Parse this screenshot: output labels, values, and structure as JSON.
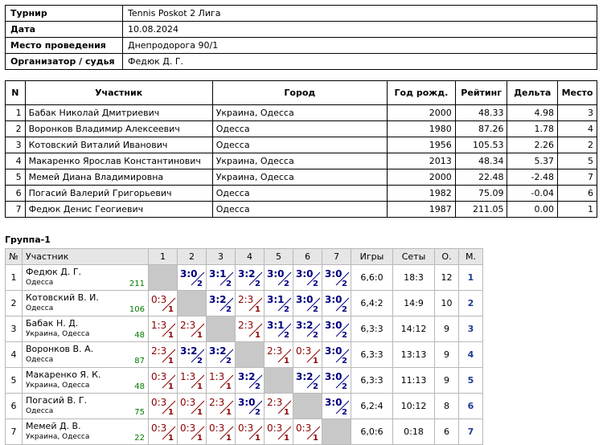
{
  "info": [
    {
      "label": "Турнир",
      "value": "Tennis Poskot   2 Лига"
    },
    {
      "label": "Дата",
      "value": "10.08.2024"
    },
    {
      "label": "Место проведения",
      "value": "Днепродорога 90/1"
    },
    {
      "label": "Организатор / судья",
      "value": "Федюк Д. Г."
    }
  ],
  "participants": {
    "headers": [
      "N",
      "Участник",
      "Город",
      "Год рожд.",
      "Рейтинг",
      "Дельта",
      "Место"
    ],
    "rows": [
      [
        "1",
        "Бабак Николай Дмитриевич",
        "Украина, Одесса",
        "2000",
        "48.33",
        "4.98",
        "3"
      ],
      [
        "2",
        "Воронков Владимир Алексеевич",
        "Одесса",
        "1980",
        "87.26",
        "1.78",
        "4"
      ],
      [
        "3",
        "Котовский Виталий Иванович",
        "Одесса",
        "1956",
        "105.53",
        "2.26",
        "2"
      ],
      [
        "4",
        "Макаренко Ярослав Константинович",
        "Украина, Одесса",
        "2013",
        "48.34",
        "5.37",
        "5"
      ],
      [
        "5",
        "Мемей Диана Владимировна",
        "Украина, Одесса",
        "2000",
        "22.48",
        "-2.48",
        "7"
      ],
      [
        "6",
        "Погасий Валерий Григорьевич",
        "Одесса",
        "1982",
        "75.09",
        "-0.04",
        "6"
      ],
      [
        "7",
        "Федюк Денис Геогиевич",
        "Одесса",
        "1987",
        "211.05",
        "0.00",
        "1"
      ]
    ]
  },
  "group": {
    "title": "Группа-1",
    "headers": [
      "№",
      "Участник",
      "1",
      "2",
      "3",
      "4",
      "5",
      "6",
      "7",
      "Игры",
      "Сеты",
      "О.",
      "М."
    ],
    "rows": [
      {
        "n": "1",
        "name": "Федюк Д. Г.",
        "city": "Одесса",
        "rating": "211",
        "results": [
          null,
          [
            "3:0",
            "2"
          ],
          [
            "3:1",
            "2"
          ],
          [
            "3:2",
            "2"
          ],
          [
            "3:0",
            "2"
          ],
          [
            "3:0",
            "2"
          ],
          [
            "3:0",
            "2"
          ]
        ],
        "games": "6,6:0",
        "sets": "18:3",
        "points": "12",
        "place": "1"
      },
      {
        "n": "2",
        "name": "Котовский В. И.",
        "city": "Одесса",
        "rating": "106",
        "results": [
          [
            "0:3",
            "1"
          ],
          null,
          [
            "3:2",
            "2"
          ],
          [
            "2:3",
            "1"
          ],
          [
            "3:1",
            "2"
          ],
          [
            "3:0",
            "2"
          ],
          [
            "3:0",
            "2"
          ]
        ],
        "games": "6,4:2",
        "sets": "14:9",
        "points": "10",
        "place": "2"
      },
      {
        "n": "3",
        "name": "Бабак Н. Д.",
        "city": "Украина, Одесса",
        "rating": "48",
        "results": [
          [
            "1:3",
            "1"
          ],
          [
            "2:3",
            "1"
          ],
          null,
          [
            "2:3",
            "1"
          ],
          [
            "3:1",
            "2"
          ],
          [
            "3:2",
            "2"
          ],
          [
            "3:0",
            "2"
          ]
        ],
        "games": "6,3:3",
        "sets": "14:12",
        "points": "9",
        "place": "3"
      },
      {
        "n": "4",
        "name": "Воронков В. А.",
        "city": "Одесса",
        "rating": "87",
        "results": [
          [
            "2:3",
            "1"
          ],
          [
            "3:2",
            "2"
          ],
          [
            "3:2",
            "2"
          ],
          null,
          [
            "2:3",
            "1"
          ],
          [
            "0:3",
            "1"
          ],
          [
            "3:0",
            "2"
          ]
        ],
        "games": "6,3:3",
        "sets": "13:13",
        "points": "9",
        "place": "4"
      },
      {
        "n": "5",
        "name": "Макаренко Я. К.",
        "city": "Украина, Одесса",
        "rating": "48",
        "results": [
          [
            "0:3",
            "1"
          ],
          [
            "1:3",
            "1"
          ],
          [
            "1:3",
            "1"
          ],
          [
            "3:2",
            "2"
          ],
          null,
          [
            "3:2",
            "2"
          ],
          [
            "3:0",
            "2"
          ]
        ],
        "games": "6,3:3",
        "sets": "11:13",
        "points": "9",
        "place": "5"
      },
      {
        "n": "6",
        "name": "Погасий В. Г.",
        "city": "Одесса",
        "rating": "75",
        "results": [
          [
            "0:3",
            "1"
          ],
          [
            "0:3",
            "1"
          ],
          [
            "2:3",
            "1"
          ],
          [
            "3:0",
            "2"
          ],
          [
            "2:3",
            "1"
          ],
          null,
          [
            "3:0",
            "2"
          ]
        ],
        "games": "6,2:4",
        "sets": "10:12",
        "points": "8",
        "place": "6"
      },
      {
        "n": "7",
        "name": "Мемей Д. В.",
        "city": "Украина, Одесса",
        "rating": "22",
        "results": [
          [
            "0:3",
            "1"
          ],
          [
            "0:3",
            "1"
          ],
          [
            "0:3",
            "1"
          ],
          [
            "0:3",
            "1"
          ],
          [
            "0:3",
            "1"
          ],
          [
            "0:3",
            "1"
          ],
          null
        ],
        "games": "6,0:6",
        "sets": "0:18",
        "points": "6",
        "place": "7"
      }
    ]
  },
  "colors": {
    "win": "#000080",
    "loss": "#8b0000",
    "rating": "#007a00",
    "place": "#1f3a93",
    "diag": "#c8c8c8",
    "header_bg": "#e6e6e6"
  }
}
